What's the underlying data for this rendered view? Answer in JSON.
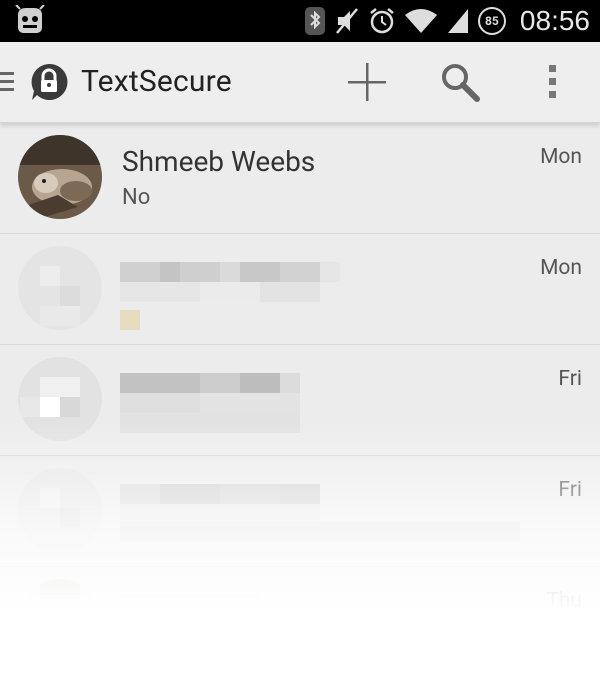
{
  "status_bar": {
    "time": "08:56",
    "battery_level": "85",
    "icons": [
      "cyanogenmod-icon",
      "bluetooth-icon",
      "mute-icon",
      "alarm-icon",
      "wifi-icon",
      "signal-icon",
      "battery-icon"
    ]
  },
  "action_bar": {
    "title": "TextSecure",
    "icons": [
      "drawer-icon",
      "textsecure-logo-icon",
      "compose-icon",
      "search-icon",
      "overflow-menu-icon"
    ]
  },
  "conversations": [
    {
      "name": "Shmeeb Weebs",
      "preview": "No",
      "date": "Mon",
      "redacted": false
    },
    {
      "name": "",
      "preview": "",
      "date": "Mon",
      "redacted": true
    },
    {
      "name": "",
      "preview": "",
      "date": "Fri",
      "redacted": true
    },
    {
      "name": "",
      "preview": "",
      "date": "Fri",
      "redacted": true
    },
    {
      "name": "",
      "preview": "",
      "date": "Thu",
      "redacted": true
    }
  ],
  "colors": {
    "status_bar_bg": "#000000",
    "action_bar_bg": "#eeeeee",
    "list_bg": "#ececec",
    "divider": "#d8d8d8"
  }
}
